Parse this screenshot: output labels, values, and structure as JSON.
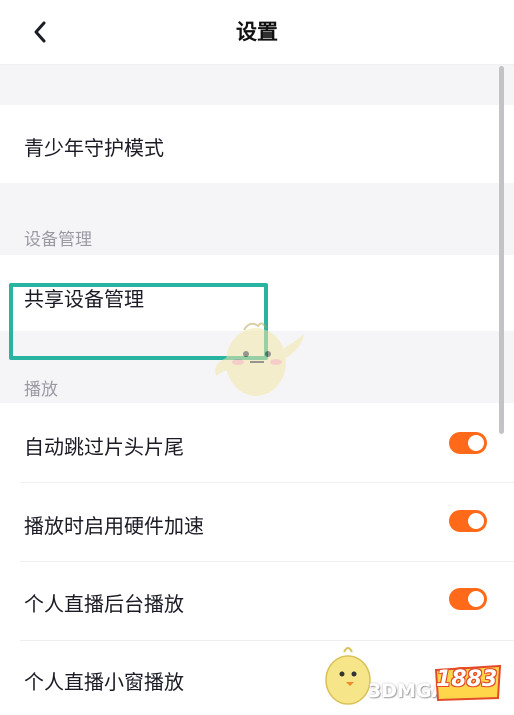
{
  "header": {
    "title": "设置",
    "back_icon": "chevron-left-icon"
  },
  "rows": {
    "teen_mode": "青少年守护模式",
    "device_section": "设备管理",
    "shared_device": "共享设备管理",
    "playback_section": "播放",
    "auto_skip": "自动跳过片头片尾",
    "hw_accel": "播放时启用硬件加速",
    "live_background": "个人直播后台播放",
    "live_small_window": "个人直播小窗播放"
  },
  "toggles": {
    "auto_skip": true,
    "hw_accel": true,
    "live_background": true,
    "live_small_window": true
  },
  "colors": {
    "accent": "#ff6a1a",
    "highlight_box": "#29b3a1",
    "section_bg": "#f5f5f8"
  },
  "watermark": {
    "text": "3DMGAME",
    "logo": "1883"
  }
}
